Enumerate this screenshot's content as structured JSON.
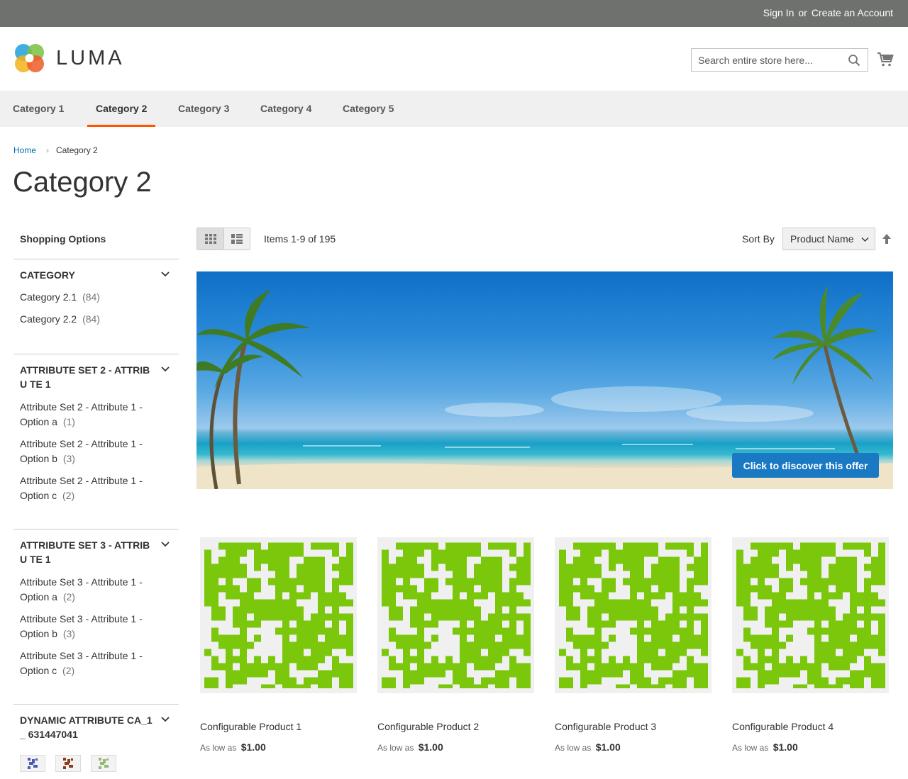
{
  "header": {
    "sign_in": "Sign In",
    "or": "or",
    "create_account": "Create an Account",
    "logo_text": "LUMA",
    "search_placeholder": "Search entire store here..."
  },
  "nav": [
    {
      "label": "Category 1",
      "active": false
    },
    {
      "label": "Category 2",
      "active": true
    },
    {
      "label": "Category 3",
      "active": false
    },
    {
      "label": "Category 4",
      "active": false
    },
    {
      "label": "Category 5",
      "active": false
    }
  ],
  "breadcrumb": {
    "home": "Home",
    "current": "Category 2"
  },
  "page_title": "Category 2",
  "sidebar": {
    "title": "Shopping Options",
    "filters": [
      {
        "title": "Category",
        "items": [
          {
            "label": "Category 2.1",
            "count": "(84)"
          },
          {
            "label": "Category 2.2",
            "count": "(84)"
          }
        ]
      },
      {
        "title": "Attribute Set 2 - Attribu te 1",
        "items": [
          {
            "label": "Attribute Set 2 - Attribute 1 - Option a",
            "count": "(1)"
          },
          {
            "label": "Attribute Set 2 - Attribute 1 - Option b",
            "count": "(3)"
          },
          {
            "label": "Attribute Set 2 - Attribute 1 - Option c",
            "count": "(2)"
          }
        ]
      },
      {
        "title": "Attribute Set 3 - Attribu te 1",
        "items": [
          {
            "label": "Attribute Set 3 - Attribute 1 - Option a",
            "count": "(2)"
          },
          {
            "label": "Attribute Set 3 - Attribute 1 - Option b",
            "count": "(3)"
          },
          {
            "label": "Attribute Set 3 - Attribute 1 - Option c",
            "count": "(2)"
          }
        ]
      },
      {
        "title": "Dynamic Attribute CA_1_ 631447041"
      }
    ]
  },
  "toolbar": {
    "amount": "Items 1-9 of 195",
    "sort_label": "Sort By",
    "sort_value": "Product Name"
  },
  "banner": {
    "cta": "Click to discover this offer"
  },
  "products": [
    {
      "name": "Configurable Product 1",
      "price_prefix": "As low as",
      "price": "$1.00"
    },
    {
      "name": "Configurable Product 2",
      "price_prefix": "As low as",
      "price": "$1.00"
    },
    {
      "name": "Configurable Product 3",
      "price_prefix": "As low as",
      "price": "$1.00"
    },
    {
      "name": "Configurable Product 4",
      "price_prefix": "As low as",
      "price": "$1.00"
    }
  ],
  "colors": {
    "topbar": "#6e716e",
    "nav_active_underline": "#ff5501",
    "link": "#006bb4",
    "cta": "#1979c3",
    "product_pattern": "#7ac70c",
    "swatch_colors": [
      "#4a5ab8",
      "#8a3a1e",
      "#93b874"
    ]
  }
}
